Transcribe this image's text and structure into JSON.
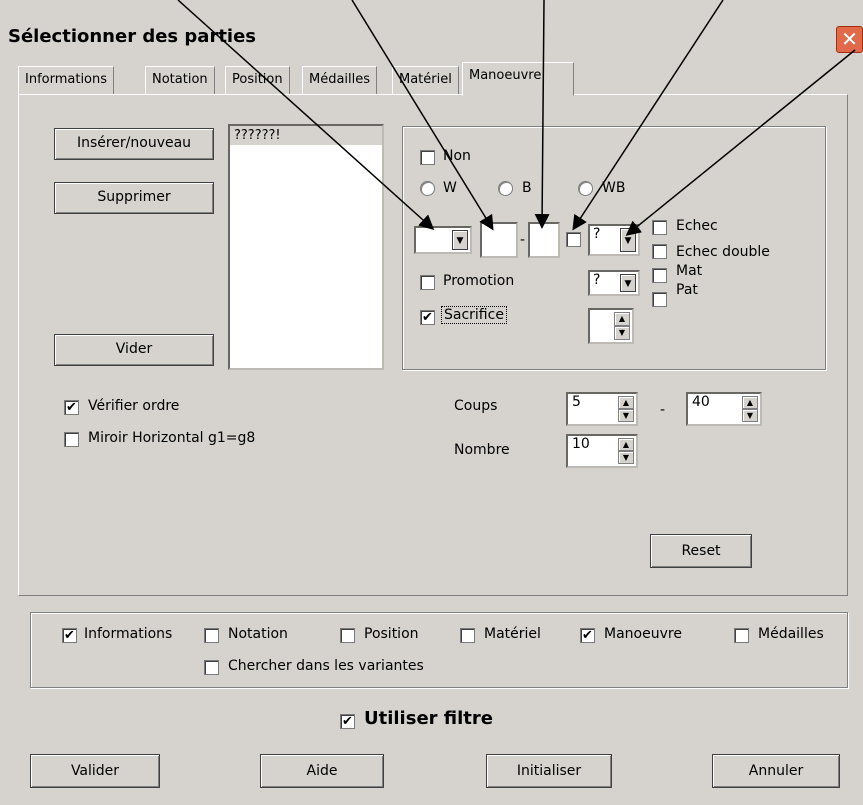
{
  "window": {
    "title": "Sélectionner des parties",
    "close_glyph": "✕"
  },
  "tabs": [
    "Informations",
    "Notation",
    "Position",
    "Médailles",
    "Matériel",
    "Manoeuvre"
  ],
  "left_buttons": {
    "insert": "Insérer/nouveau",
    "delete": "Supprimer",
    "clear": "Vider"
  },
  "move_list": [
    "??????!"
  ],
  "manoeuvre": {
    "non_label": "Non",
    "color_options": [
      "W",
      "B",
      "WB"
    ],
    "piece_value": "",
    "from_value": "",
    "dash": "-",
    "to_value": "",
    "annotation_value": "?",
    "promotion_label": "Promotion",
    "promotion_value": "?",
    "sacrifice_label": "Sacrifice",
    "sacrifice_checked": true,
    "check_options": [
      "Echec",
      "Echec double",
      "Mat",
      "Pat"
    ]
  },
  "options": {
    "verify_order": "Vérifier ordre",
    "verify_order_checked": true,
    "mirror": "Miroir Horizontal g1=g8",
    "mirror_checked": false
  },
  "coups": {
    "label": "Coups",
    "from": "5",
    "dash": "-",
    "to": "40"
  },
  "nombre": {
    "label": "Nombre",
    "value": "10"
  },
  "reset_label": "Reset",
  "filters": {
    "informations": "Informations",
    "notation": "Notation",
    "position": "Position",
    "materiel": "Matériel",
    "manoeuvre": "Manoeuvre",
    "medailles": "Médailles",
    "variantes": "Chercher dans les variantes"
  },
  "use_filter": {
    "label": "Utiliser filtre",
    "checked": true
  },
  "bottom_buttons": {
    "valider": "Valider",
    "aide": "Aide",
    "initialiser": "Initialiser",
    "annuler": "Annuler"
  },
  "check_glyph": "✔",
  "arrow_glyph": "▼",
  "spin_up": "▲",
  "spin_down": "▼"
}
